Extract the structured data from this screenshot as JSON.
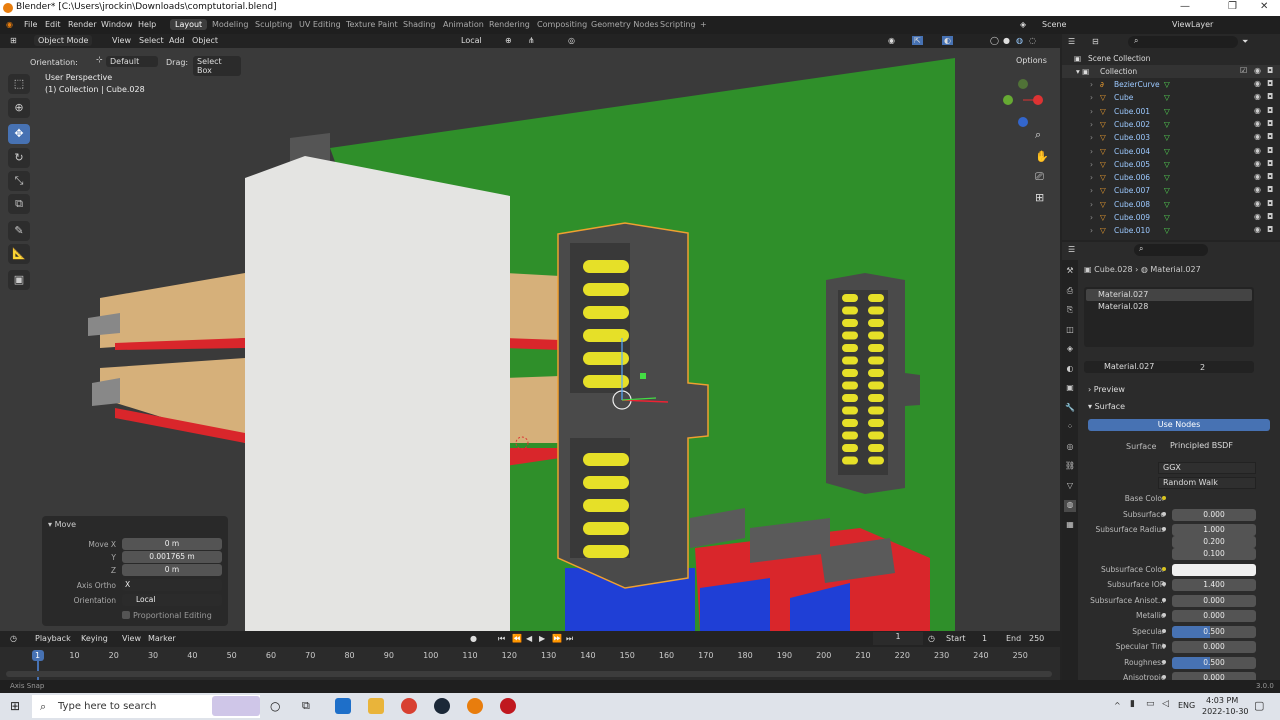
{
  "title_bar": {
    "text": "Blender* [C:\\Users\\jrockin\\Downloads\\comptutorial.blend]"
  },
  "menu": {
    "items": [
      "File",
      "Edit",
      "Render",
      "Window",
      "Help"
    ]
  },
  "workspaces": [
    "Layout",
    "Modeling",
    "Sculpting",
    "UV Editing",
    "Texture Paint",
    "Shading",
    "Animation",
    "Rendering",
    "Compositing",
    "Geometry Nodes",
    "Scripting"
  ],
  "scene": {
    "label": "Scene",
    "view_layer": "ViewLayer"
  },
  "viewport_header": {
    "mode": "Object Mode",
    "view": "View",
    "select": "Select",
    "add": "Add",
    "object": "Object",
    "transform_orientation": "Local",
    "orientation_label": "Orientation:",
    "orientation_value": "Default",
    "drag_label": "Drag:",
    "drag_value": "Select Box",
    "options": "Options"
  },
  "viewport_info": {
    "perspective": "User Perspective",
    "collection": "(1) Collection | Cube.028"
  },
  "move_panel": {
    "title": "Move",
    "move_x_label": "Move X",
    "move_x": "0 m",
    "y_label": "Y",
    "y": "0.001765 m",
    "z_label": "Z",
    "z": "0 m",
    "axis_ortho_label": "Axis Ortho",
    "axis_ortho": "X",
    "orientation_label": "Orientation",
    "orientation": "Local",
    "proportional": "Proportional Editing"
  },
  "outliner": {
    "scene_collection": "Scene Collection",
    "collection": "Collection",
    "items": [
      "BezierCurve",
      "Cube",
      "Cube.001",
      "Cube.002",
      "Cube.003",
      "Cube.004",
      "Cube.005",
      "Cube.006",
      "Cube.007",
      "Cube.008",
      "Cube.009",
      "Cube.010"
    ]
  },
  "properties": {
    "breadcrumb_object": "Cube.028",
    "breadcrumb_material": "Material.027",
    "slots": [
      "Material.027",
      "Material.028"
    ],
    "material_name": "Material.027",
    "users": "2",
    "preview": "Preview",
    "surface_panel": "Surface",
    "use_nodes": "Use Nodes",
    "surface_label": "Surface",
    "surface_value": "Principled BSDF",
    "distribution": "GGX",
    "subsurface_method": "Random Walk",
    "rows": [
      {
        "label": "Base Color",
        "value": ""
      },
      {
        "label": "Subsurface",
        "value": "0.000"
      },
      {
        "label": "Subsurface Radius",
        "value": "1.000"
      },
      {
        "label": "",
        "value": "0.200"
      },
      {
        "label": "",
        "value": "0.100"
      },
      {
        "label": "Subsurface Color",
        "value": ""
      },
      {
        "label": "Subsurface IOR",
        "value": "1.400"
      },
      {
        "label": "Subsurface Anisot...",
        "value": "0.000"
      },
      {
        "label": "Metallic",
        "value": "0.000"
      },
      {
        "label": "Specular",
        "value": "0.500"
      },
      {
        "label": "Specular Tint",
        "value": "0.000"
      },
      {
        "label": "Roughness",
        "value": "0.500"
      },
      {
        "label": "Anisotropic",
        "value": "0.000"
      }
    ]
  },
  "timeline": {
    "playback": "Playback",
    "keying": "Keying",
    "view": "View",
    "marker": "Marker",
    "current_frame": "1",
    "start_label": "Start",
    "start": "1",
    "end_label": "End",
    "end": "250",
    "ruler": [
      "1",
      "10",
      "20",
      "30",
      "40",
      "50",
      "60",
      "70",
      "80",
      "90",
      "100",
      "110",
      "120",
      "130",
      "140",
      "150",
      "160",
      "170",
      "180",
      "190",
      "200",
      "210",
      "220",
      "230",
      "240",
      "250"
    ]
  },
  "status": {
    "left": "Axis Snap",
    "version": "3.0.0"
  },
  "taskbar": {
    "search_placeholder": "Type here to search",
    "time": "4:03 PM",
    "date": "2022-10-30",
    "lang": "ENG"
  },
  "colors": {
    "accent": "#4772b3",
    "selection_orange": "#f0a030",
    "viewport_green": "#2f8f2a"
  }
}
